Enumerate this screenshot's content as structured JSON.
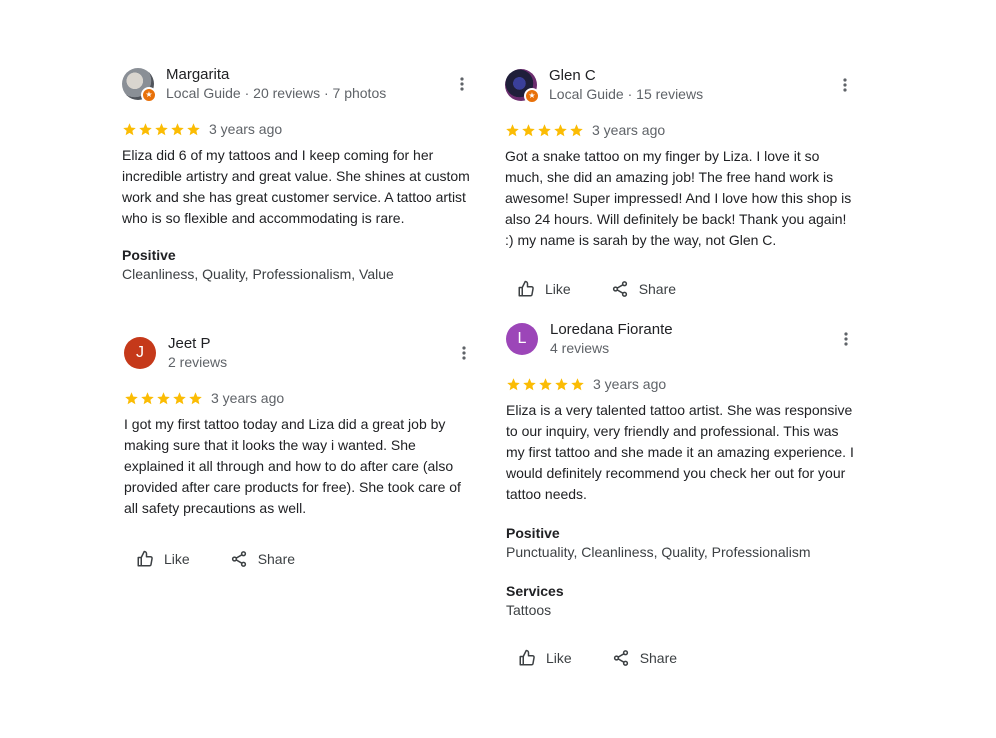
{
  "colors": {
    "star": "#fbbc04",
    "avatar_j": "#c5391a",
    "avatar_l": "#9c46b8",
    "local_guide_badge": "#e8710a"
  },
  "reviews": [
    {
      "name": "Margarita",
      "meta": "Local Guide · 20 reviews · 7 photos",
      "avatar_icon": "profile-photo-icon",
      "local_guide": true,
      "rating": 5,
      "date": "3 years ago",
      "text": "Eliza did 6 of my tattoos and I keep coming for her incredible artistry and great value. She shines at custom work and she has great customer service. A tattoo artist who is so flexible and accommodating is rare.",
      "positive_label": "Positive",
      "positive_value": "Cleanliness, Quality, Professionalism, Value"
    },
    {
      "name": "Jeet P",
      "meta": "2 reviews",
      "avatar_letter": "J",
      "rating": 5,
      "date": "3 years ago",
      "text": "I got my first tattoo today and Liza did a great job by making sure that it looks the way i wanted. She explained it all through and how to do after care (also provided after care products for free). She took care of all safety precautions as well.",
      "like_label": "Like",
      "share_label": "Share"
    },
    {
      "name": "Glen C",
      "meta": "Local Guide · 15 reviews",
      "avatar_icon": "profile-photo-icon",
      "local_guide": true,
      "rating": 5,
      "date": "3 years ago",
      "text": "Got a snake tattoo on my finger by Liza. I love it so much, she did an amazing job! The free hand work is awesome! Super impressed! And I love how this shop is also 24 hours. Will definitely be back! Thank you again! :) my name is sarah by the way, not Glen C.",
      "like_label": "Like",
      "share_label": "Share"
    },
    {
      "name": "Loredana Fiorante",
      "meta": "4 reviews",
      "avatar_letter": "L",
      "rating": 5,
      "date": "3 years ago",
      "text": "Eliza is a very talented tattoo artist. She was responsive to our inquiry, very friendly and professional. This was my first tattoo and she made it an amazing experience. I would definitely recommend you check her out for your tattoo needs.",
      "positive_label": "Positive",
      "positive_value": "Punctuality, Cleanliness, Quality, Professionalism",
      "services_label": "Services",
      "services_value": "Tattoos",
      "like_label": "Like",
      "share_label": "Share"
    }
  ]
}
